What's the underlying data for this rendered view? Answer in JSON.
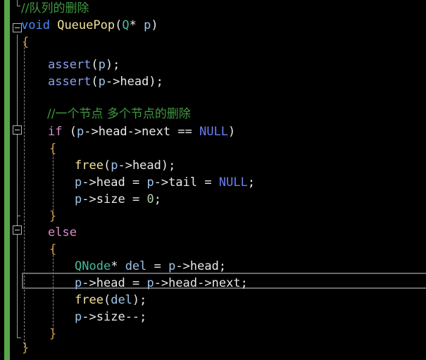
{
  "editor": {
    "app": "code-editor",
    "language": "C",
    "theme": "dark",
    "background_color": "#000000",
    "change_indicator_color": "#57a64a",
    "current_line_border_color": "#686868",
    "indent_guide_color": "#8c8c8c",
    "fold_margin_color": "#9a9a9a"
  },
  "colors": {
    "comment": "#3f9a3f",
    "keyword": "#4a8df8",
    "control": "#d88ec8",
    "function": "#f0e09a",
    "type": "#49b9a0",
    "variable": "#9fc5e8",
    "macro": "#8e9ff0",
    "plain": "#e8e8e8",
    "brace": "#d09a4a",
    "constant": "#6a7ef0",
    "number": "#b5cea8"
  },
  "code_lines": [
    {
      "id": "line-comment-queue-pop",
      "text": "//队列的删除"
    },
    {
      "id": "line-func-signature",
      "text": "void QueuePop(Q* p)"
    },
    {
      "id": "line-func-open-brace",
      "text": "{"
    },
    {
      "id": "line-blank-1",
      "text": ""
    },
    {
      "id": "line-assert-p",
      "text": "assert(p);"
    },
    {
      "id": "line-assert-head",
      "text": "assert(p->head);"
    },
    {
      "id": "line-blank-2",
      "text": ""
    },
    {
      "id": "line-comment-nodes",
      "text": "//一个节点 多个节点的删除"
    },
    {
      "id": "line-if-condition",
      "text": "if (p->head->next == NULL)"
    },
    {
      "id": "line-if-open-brace",
      "text": "{"
    },
    {
      "id": "line-free-head",
      "text": "free(p->head);"
    },
    {
      "id": "line-null-head-tail",
      "text": "p->head = p->tail = NULL;"
    },
    {
      "id": "line-size-zero",
      "text": "p->size = 0;"
    },
    {
      "id": "line-if-close-brace",
      "text": "}"
    },
    {
      "id": "line-else",
      "text": "else"
    },
    {
      "id": "line-else-open-brace",
      "text": "{"
    },
    {
      "id": "line-qnode-del",
      "text": "QNode* del = p->head;"
    },
    {
      "id": "line-head-next",
      "text": "p->head = p->head->next;"
    },
    {
      "id": "line-free-del",
      "text": "free(del);"
    },
    {
      "id": "line-size-decrement",
      "text": "p->size--;"
    },
    {
      "id": "line-else-close-brace",
      "text": "}"
    },
    {
      "id": "line-func-close-brace",
      "text": "}"
    }
  ],
  "tokens": {
    "comment_queue_pop": "//队列的删除",
    "comment_nodes": "//一个节点 多个节点的删除",
    "kw_void": "void",
    "fn_queuepop": "QueuePop",
    "type_q": "Q",
    "var_p": "p",
    "macro_assert": "assert",
    "fn_free": "free",
    "ctl_if": "if",
    "ctl_else": "else",
    "const_null": "NULL",
    "type_qnode": "QNode",
    "var_del": "del",
    "member_head": "head",
    "member_tail": "tail",
    "member_next": "next",
    "member_size": "size",
    "num_zero": "0",
    "op_arrow": "->",
    "op_assign": "=",
    "op_equals": "==",
    "op_decrement": "--",
    "op_star": "*",
    "paren_open": "(",
    "paren_close": ")",
    "brace_open": "{",
    "brace_close": "}",
    "semicolon": ";"
  },
  "gutter": {
    "fold_boxes": [
      {
        "name": "fold-box-function",
        "line": "line-func-signature",
        "state": "expanded",
        "glyph": "minus"
      },
      {
        "name": "fold-box-if",
        "line": "line-if-condition",
        "state": "expanded",
        "glyph": "minus"
      },
      {
        "name": "fold-box-else",
        "line": "line-else",
        "state": "expanded",
        "glyph": "minus"
      }
    ]
  },
  "current_line": {
    "name": "current-line-highlight",
    "line_id": "line-head-next",
    "text": "p->head = p->head->next;"
  }
}
